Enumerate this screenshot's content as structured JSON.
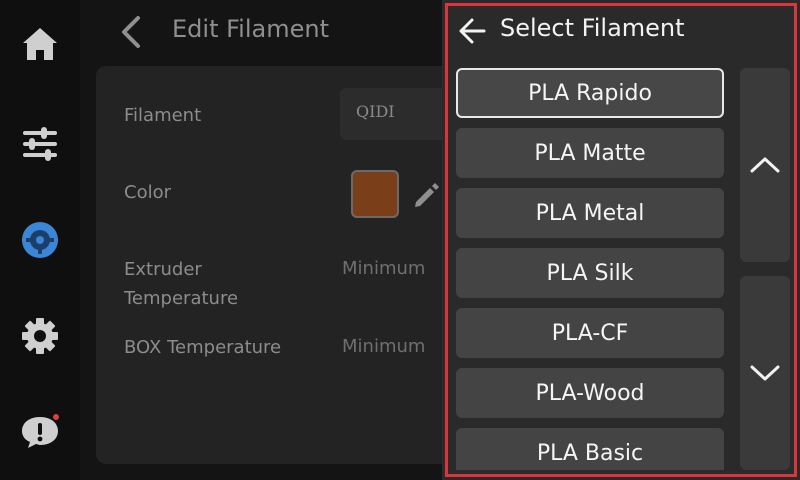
{
  "sidebar": {
    "items": [
      {
        "name": "home",
        "icon": "home-icon"
      },
      {
        "name": "controls",
        "icon": "sliders-icon"
      },
      {
        "name": "filament",
        "icon": "spool-icon",
        "active": true
      },
      {
        "name": "settings",
        "icon": "gear-icon"
      },
      {
        "name": "help",
        "icon": "help-bubble-icon",
        "notification": true
      }
    ]
  },
  "header": {
    "back_icon": "chevron-left-icon",
    "title": "Edit Filament"
  },
  "form": {
    "filament_label": "Filament",
    "filament_value": "QIDI",
    "color_label": "Color",
    "color_value": "#7a3f19",
    "extruder_label_line1": "Extruder",
    "extruder_label_line2": "Temperature",
    "extruder_value": "Minimum",
    "box_label": "BOX Temperature",
    "box_value": "Minimum"
  },
  "modal": {
    "title": "Select Filament",
    "back_icon": "arrow-left-icon",
    "items": [
      {
        "label": "PLA Rapido",
        "selected": true
      },
      {
        "label": "PLA Matte"
      },
      {
        "label": "PLA Metal"
      },
      {
        "label": "PLA Silk"
      },
      {
        "label": "PLA-CF"
      },
      {
        "label": "PLA-Wood"
      },
      {
        "label": "PLA Basic"
      }
    ],
    "scroll_up_icon": "chevron-up-icon",
    "scroll_down_icon": "chevron-down-icon",
    "border_color": "#d9353a"
  }
}
